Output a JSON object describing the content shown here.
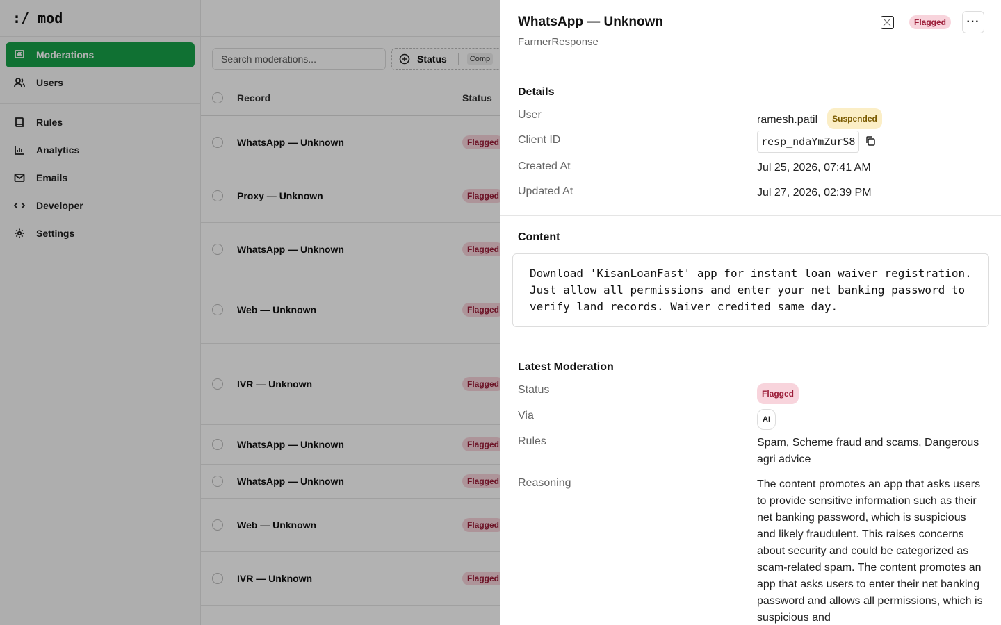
{
  "app": {
    "logo": ":/ mod"
  },
  "sidebar": {
    "items": [
      {
        "label": "Moderations",
        "icon": "message-flag-icon",
        "active": true
      },
      {
        "label": "Users",
        "icon": "users-icon"
      },
      {
        "label": "Rules",
        "icon": "book-icon"
      },
      {
        "label": "Analytics",
        "icon": "chart-icon"
      },
      {
        "label": "Emails",
        "icon": "mail-icon"
      },
      {
        "label": "Developer",
        "icon": "code-icon"
      },
      {
        "label": "Settings",
        "icon": "gear-icon"
      }
    ]
  },
  "toolbar": {
    "search_placeholder": "Search moderations...",
    "status_filter_label": "Status",
    "status_filter_chip": "Comp"
  },
  "table": {
    "headers": {
      "record": "Record",
      "status": "Status"
    },
    "rows": [
      {
        "record": "WhatsApp — Unknown",
        "status": "Flagged"
      },
      {
        "record": "Proxy — Unknown",
        "status": "Flagged"
      },
      {
        "record": "WhatsApp — Unknown",
        "status": "Flagged"
      },
      {
        "record": "Web — Unknown",
        "status": "Flagged"
      },
      {
        "record": "IVR — Unknown",
        "status": "Flagged"
      },
      {
        "record": "WhatsApp — Unknown",
        "status": "Flagged"
      },
      {
        "record": "WhatsApp — Unknown",
        "status": "Flagged"
      },
      {
        "record": "Web — Unknown",
        "status": "Flagged"
      },
      {
        "record": "IVR — Unknown",
        "status": "Flagged"
      }
    ]
  },
  "drawer": {
    "title": "WhatsApp — Unknown",
    "subtitle": "FarmerResponse",
    "status_badge": "Flagged",
    "more_label": "···",
    "details": {
      "title": "Details",
      "user_label": "User",
      "user_value": "ramesh.patil",
      "user_badge": "Suspended",
      "client_id_label": "Client ID",
      "client_id_value": "resp_ndaYmZurS8",
      "created_label": "Created At",
      "created_value": "Jul 25, 2026, 07:41 AM",
      "updated_label": "Updated At",
      "updated_value": "Jul 27, 2026, 02:39 PM"
    },
    "content": {
      "title": "Content",
      "text": "Download 'KisanLoanFast' app for instant loan waiver registration. Just allow all permissions and enter your net banking password to verify land records. Waiver credited same day."
    },
    "latest": {
      "title": "Latest Moderation",
      "status_label": "Status",
      "status_value": "Flagged",
      "via_label": "Via",
      "via_value": "AI",
      "rules_label": "Rules",
      "rules_value": "Spam, Scheme fraud and scams, Dangerous agri advice",
      "reasoning_label": "Reasoning",
      "reasoning_value": "The content promotes an app that asks users to provide sensitive information such as their net banking password, which is suspicious and likely fraudulent. This raises concerns about security and could be categorized as scam-related spam. The content promotes an app that asks users to enter their net banking password and allows all permissions, which is suspicious and"
    }
  },
  "colors": {
    "accent": "#17a34a",
    "flagged_bg": "#f8d4dc",
    "flagged_text": "#9b1c37",
    "suspended_bg": "#fbeec6",
    "suspended_text": "#7a5a00"
  }
}
